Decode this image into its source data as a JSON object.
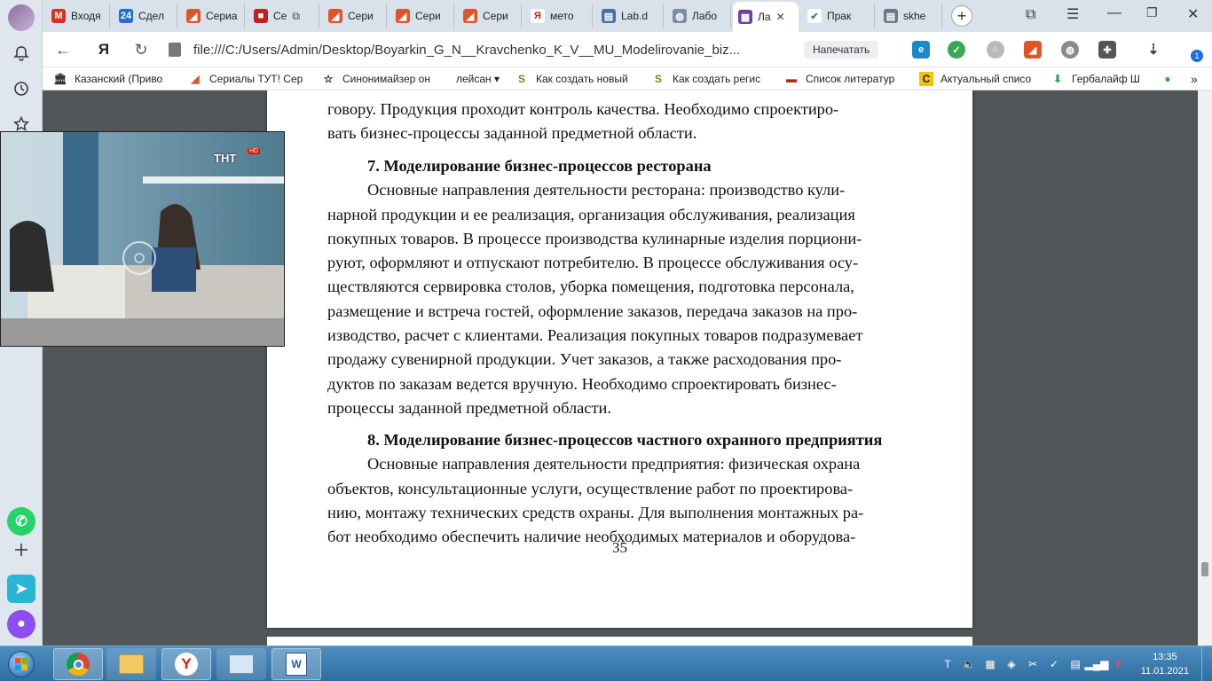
{
  "sidepanel": {
    "items": [
      {
        "name": "profile-avatar",
        "icon": "avatar"
      },
      {
        "name": "notifications",
        "icon": "bell-icon"
      },
      {
        "name": "history",
        "icon": "clock-icon"
      },
      {
        "name": "bookmarks",
        "icon": "star-icon"
      },
      {
        "name": "whatsapp",
        "icon": "whatsapp-icon"
      },
      {
        "name": "add",
        "icon": "plus-icon"
      },
      {
        "name": "messenger",
        "icon": "paper-plane-icon"
      },
      {
        "name": "alice",
        "icon": "alice-icon"
      }
    ]
  },
  "tabs": [
    {
      "label": "Входя",
      "icon": "M",
      "color": "#d93025"
    },
    {
      "label": "Сдел",
      "icon": "24",
      "color": "#1e6fd9"
    },
    {
      "label": "Сериа",
      "icon": "◢",
      "color": "#e0542b"
    },
    {
      "label": "Се",
      "icon": "■",
      "color": "#c0201f"
    },
    {
      "label": "Сери",
      "icon": "◢",
      "color": "#e0542b"
    },
    {
      "label": "Сери",
      "icon": "◢",
      "color": "#e0542b"
    },
    {
      "label": "Сери",
      "icon": "◢",
      "color": "#e0542b"
    },
    {
      "label": "мето",
      "icon": "Я",
      "color": "#e61400"
    },
    {
      "label": "Lab.d",
      "icon": "▤",
      "color": "#4a6fa5"
    },
    {
      "label": "Лабо",
      "icon": "◍",
      "color": "#7a8ea8"
    },
    {
      "label": "Ла",
      "icon": "▦",
      "color": "#6b3fa0"
    },
    {
      "label": "Прак",
      "icon": "✔",
      "color": "#2e8b57"
    },
    {
      "label": "skhe",
      "icon": "▤",
      "color": "#6a7785"
    }
  ],
  "address": {
    "url": "file:///C:/Users/Admin/Desktop/Boyarkin_G_N__Kravchenko_K_V__MU_Modelirovanie_biz...",
    "print_label": "Напечатать",
    "downloads_badge": "1"
  },
  "bookmarks": [
    {
      "label": "Казанский (Приво",
      "icon": "🏛"
    },
    {
      "label": "Сериалы ТУТ! Сер",
      "icon": "◢"
    },
    {
      "label": "Синонимайзер он",
      "icon": "☆"
    },
    {
      "label": "лейсан ▾",
      "icon": ""
    },
    {
      "label": "Как создать новый",
      "icon": "S"
    },
    {
      "label": "Как создать регис",
      "icon": "S"
    },
    {
      "label": "Список литератур",
      "icon": "▬"
    },
    {
      "label": "Актуальный списо",
      "icon": "C"
    },
    {
      "label": "Гербалайф Ш",
      "icon": "⬇"
    }
  ],
  "document": {
    "intro_lines": [
      "говору. Продукция проходит контроль качества. Необходимо спроектиро-",
      "вать бизнес-процессы заданной предметной области."
    ],
    "section7": {
      "title": "7. Моделирование бизнес-процессов ресторана",
      "lines": [
        "Основные направления деятельности ресторана: производство кули-",
        "нарной продукции и ее реализация, организация обслуживания, реализация",
        "покупных товаров. В процессе производства кулинарные изделия порциони-",
        "руют, оформляют и отпускают потребителю. В процессе обслуживания осу-",
        "ществляются сервировка столов, уборка помещения, подготовка персонала,",
        "размещение и встреча гостей, оформление заказов, передача заказов на про-",
        "изводство, расчет с клиентами. Реализация покупных товаров подразумевает",
        "продажу сувенирной продукции. Учет заказов, а также расходования про-",
        "дуктов по заказам ведется вручную. Необходимо спроектировать бизнес-",
        "процессы заданной предметной области."
      ]
    },
    "section8": {
      "title": "8. Моделирование бизнес-процессов частного охранного предприятия",
      "lines": [
        "Основные направления деятельности предприятия: физическая охрана",
        "объектов, консультационные услуги, осуществление работ по проектирова-",
        "нию, монтажу технических средств охраны. Для выполнения монтажных ра-",
        "бот необходимо обеспечить наличие необходимых материалов и оборудова-"
      ]
    },
    "page_number": "35"
  },
  "video": {
    "channel_logo": "ТНТ",
    "channel_badge": "HD"
  },
  "taskbar": {
    "apps": [
      "chrome",
      "file-explorer",
      "yandex-browser",
      "control-panel",
      "word"
    ],
    "time": "13:35",
    "date": "11.01.2021"
  }
}
